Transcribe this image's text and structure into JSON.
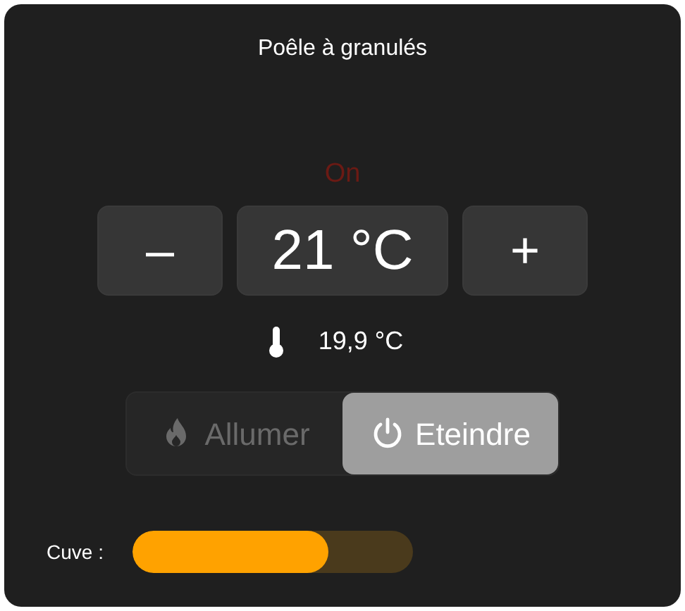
{
  "title": "Poêle à granulés",
  "status": "On",
  "setpoint": {
    "decrease": "–",
    "value": "21 °C",
    "increase": "+"
  },
  "temperature": "19,9 °C",
  "modes": [
    {
      "kind": "flame",
      "label": "Allumer",
      "selected": false
    },
    {
      "kind": "power",
      "label": "Eteindre",
      "selected": true
    }
  ],
  "tank": {
    "label": "Cuve :",
    "level": 0.7
  }
}
